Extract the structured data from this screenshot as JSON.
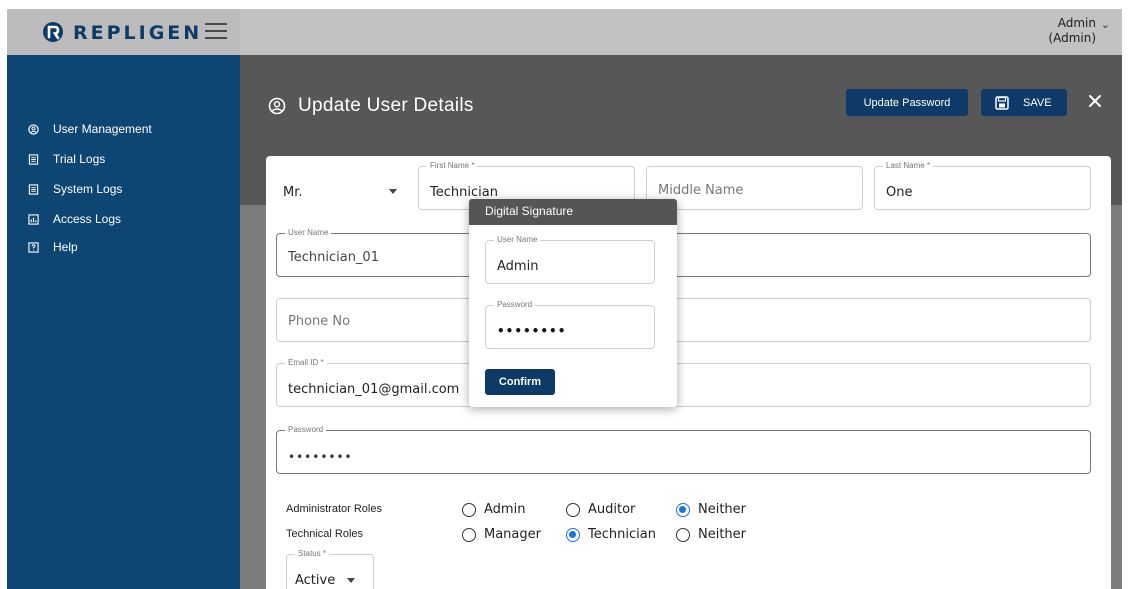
{
  "header": {
    "brand": "REPLIGEN",
    "user_name": "Admin",
    "user_role": "(Admin)"
  },
  "sidebar": {
    "items": [
      {
        "label": "User Management",
        "icon": "account-circle-icon"
      },
      {
        "label": "Trial Logs",
        "icon": "document-list-icon"
      },
      {
        "label": "System Logs",
        "icon": "document-list-icon"
      },
      {
        "label": "Access Logs",
        "icon": "chart-box-icon"
      },
      {
        "label": "Help",
        "icon": "help-box-icon"
      }
    ]
  },
  "page": {
    "title": "Update User Details",
    "update_password_label": "Update Password",
    "save_label": "SAVE"
  },
  "form": {
    "salutation": "Mr.",
    "first_name_label": "First Name *",
    "first_name": "Technician",
    "middle_name_placeholder": "Middle Name",
    "last_name_label": "Last Name *",
    "last_name": "One",
    "user_name_label": "User Name",
    "user_name": "Technician_01",
    "phone_placeholder": "Phone No",
    "email_label": "Email ID *",
    "email": "technician_01@gmail.com",
    "password_label": "Password",
    "password_mask": "••••••••",
    "admin_roles_label": "Administrator Roles",
    "admin_roles": [
      {
        "label": "Admin",
        "selected": false
      },
      {
        "label": "Auditor",
        "selected": false
      },
      {
        "label": "Neither",
        "selected": true
      }
    ],
    "tech_roles_label": "Technical Roles",
    "tech_roles": [
      {
        "label": "Manager",
        "selected": false
      },
      {
        "label": "Technician",
        "selected": true
      },
      {
        "label": "Neither",
        "selected": false
      }
    ],
    "status_label": "Status *",
    "status": "Active"
  },
  "dialog": {
    "title": "Digital Signature",
    "user_name_label": "User Name",
    "user_name": "Admin",
    "password_label": "Password",
    "password_mask": "••••••••",
    "confirm_label": "Confirm"
  },
  "colors": {
    "brand_navy": "#0d3a66",
    "sidebar_bg": "#0d4673",
    "radio_selected": "#1976d2"
  }
}
